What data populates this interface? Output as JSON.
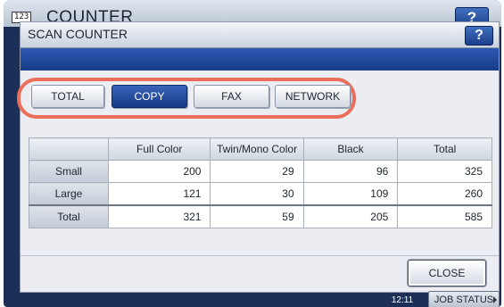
{
  "screen": {
    "icon_text": "123",
    "title": "COUNTER",
    "help_label": "?"
  },
  "dialog": {
    "title": "SCAN COUNTER",
    "help_label": "?"
  },
  "tabs": [
    {
      "label": "TOTAL",
      "active": false
    },
    {
      "label": "COPY",
      "active": true
    },
    {
      "label": "FAX",
      "active": false
    },
    {
      "label": "NETWORK",
      "active": false
    }
  ],
  "table": {
    "columns": [
      "",
      "Full Color",
      "Twin/Mono Color",
      "Black",
      "Total"
    ],
    "rows": [
      {
        "label": "Small",
        "values": [
          "200",
          "29",
          "96",
          "325"
        ]
      },
      {
        "label": "Large",
        "values": [
          "121",
          "30",
          "109",
          "260"
        ]
      },
      {
        "label": "Total",
        "values": [
          "321",
          "59",
          "205",
          "585"
        ]
      }
    ]
  },
  "close_label": "CLOSE",
  "status": {
    "time": "12:11",
    "job_status_label": "JOB STATUS"
  },
  "colors": {
    "highlight_ring": "#e96f5a",
    "active_tab": "#173a86",
    "title_bar": "#1b2f57"
  }
}
